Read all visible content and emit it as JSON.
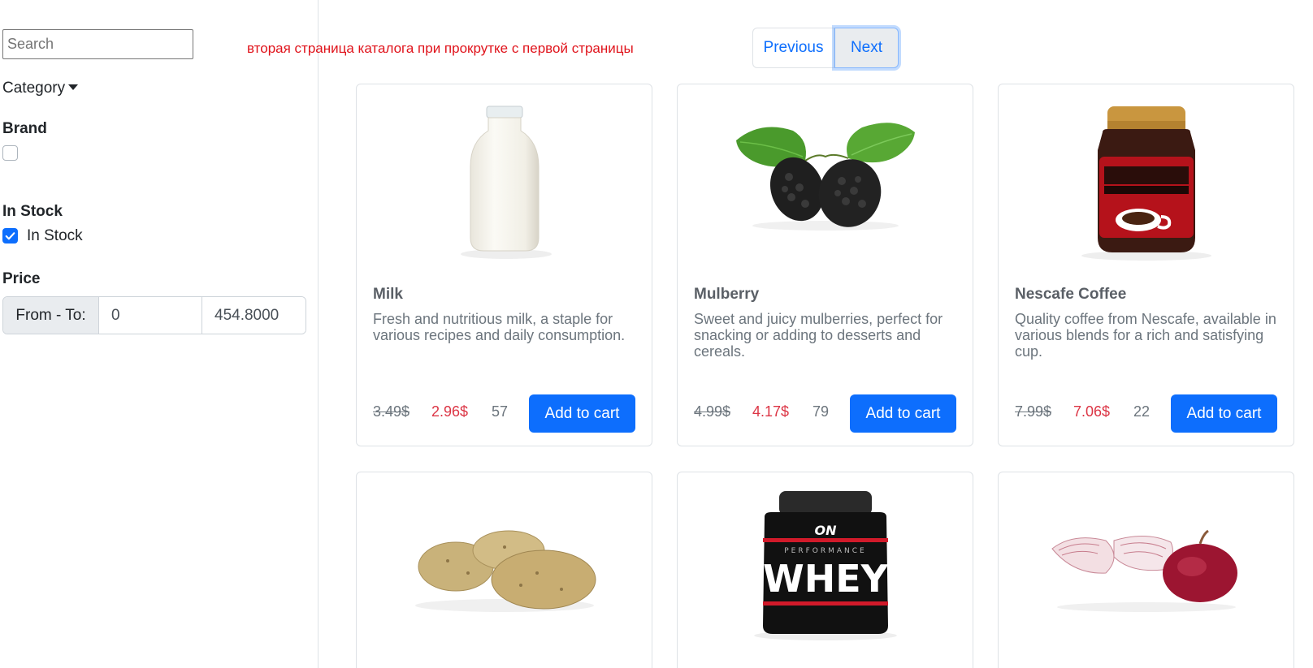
{
  "sidebar": {
    "search_placeholder": "Search",
    "category_label": "Category",
    "brand_title": "Brand",
    "instock_title": "In Stock",
    "instock_label": "In Stock",
    "price_title": "Price",
    "price_prefix": "From - To:",
    "price_from": "0",
    "price_to": "454.8000"
  },
  "note": "вторая страница каталога при прокрутке с первой страницы",
  "pagination": {
    "previous": "Previous",
    "next": "Next"
  },
  "products": [
    {
      "title": "Milk",
      "description": "Fresh and nutritious milk, a staple for various recipes and daily consumption.",
      "old_price": "3.49$",
      "new_price": "2.96$",
      "stock": "57",
      "button": "Add to cart",
      "image": "milk-bottle"
    },
    {
      "title": "Mulberry",
      "description": "Sweet and juicy mulberries, perfect for snacking or adding to desserts and cereals.",
      "old_price": "4.99$",
      "new_price": "4.17$",
      "stock": "79",
      "button": "Add to cart",
      "image": "mulberry"
    },
    {
      "title": "Nescafe Coffee",
      "description": "Quality coffee from Nescafe, available in various blends for a rich and satisfying cup.",
      "old_price": "7.99$",
      "new_price": "7.06$",
      "stock": "22",
      "button": "Add to cart",
      "image": "nescafe-jar"
    },
    {
      "image": "potatoes"
    },
    {
      "image": "whey-protein",
      "label_brand": "ON",
      "label_line": "PERFORMANCE",
      "label_main": "WHEY"
    },
    {
      "image": "red-onion"
    }
  ],
  "colors": {
    "primary": "#0d6efd",
    "sale": "#dc3545",
    "note": "#e0131b"
  }
}
